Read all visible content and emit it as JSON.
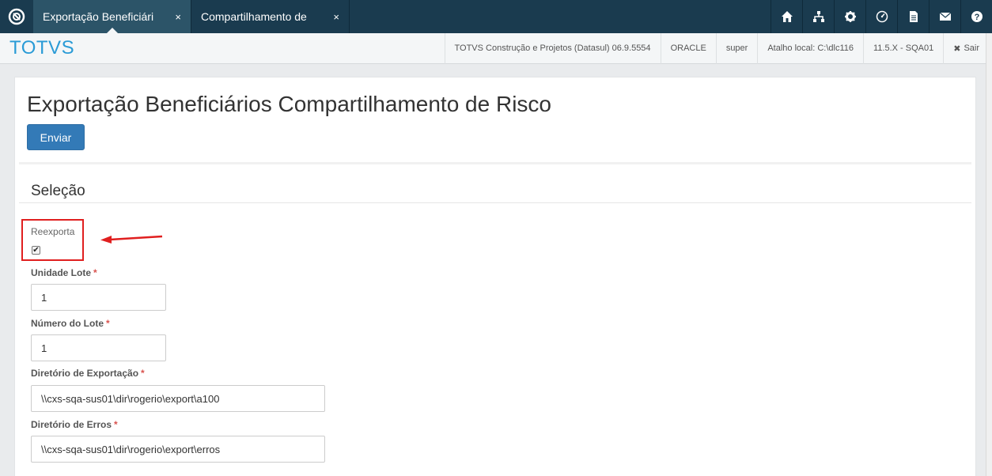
{
  "tabs": [
    {
      "label": "Exportação Beneficiári",
      "close": "×"
    },
    {
      "label": "Compartilhamento de",
      "close": "×"
    }
  ],
  "top_icons": [
    "home-icon",
    "sitemap-icon",
    "gear-icon",
    "dashboard-icon",
    "document-icon",
    "mail-icon",
    "help-icon"
  ],
  "header": {
    "brand": "TOTVS",
    "product": "TOTVS Construção e Projetos (Datasul) 06.9.5554",
    "database": "ORACLE",
    "user": "super",
    "shortcut": "Atalho local: C:\\dlc116",
    "version": "11.5.X - SQA01",
    "exit_icon": "✖",
    "exit_label": "Sair"
  },
  "page": {
    "title": "Exportação Beneficiários Compartilhamento de Risco",
    "send_button": "Enviar",
    "section": "Seleção"
  },
  "form": {
    "reexporta": {
      "label": "Reexporta",
      "checked": true
    },
    "unidade_lote": {
      "label": "Unidade Lote",
      "required": "*",
      "value": "1"
    },
    "numero_lote": {
      "label": "Número do Lote",
      "required": "*",
      "value": "1"
    },
    "diretorio_exportacao": {
      "label": "Diretório de Exportação",
      "required": "*",
      "value": "\\\\cxs-sqa-sus01\\dir\\rogerio\\export\\a100"
    },
    "diretorio_erros": {
      "label": "Diretório de Erros",
      "required": "*",
      "value": "\\\\cxs-sqa-sus01\\dir\\rogerio\\export\\erros"
    }
  },
  "colors": {
    "topbar": "#1a3b4f",
    "active_tab": "#2c5468",
    "brand": "#2a9bd6",
    "primary_button": "#337ab7",
    "highlight": "#e01f1f",
    "required": "#d9534f"
  }
}
